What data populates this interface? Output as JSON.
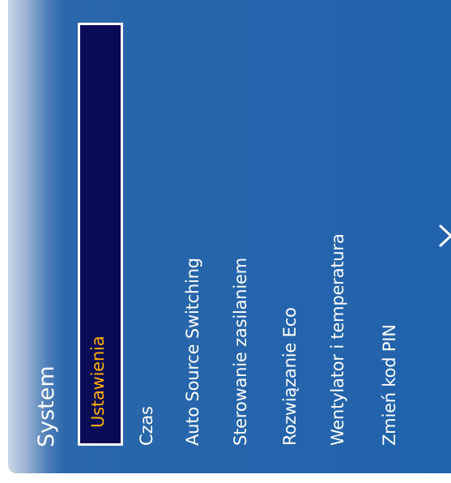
{
  "menu": {
    "title": "System",
    "items": [
      {
        "label": "Ustawienia",
        "selected": true
      },
      {
        "label": "Czas"
      },
      {
        "label": "Auto Source Switching"
      },
      {
        "label": "Sterowanie zasilaniem"
      },
      {
        "label": "Rozwiązanie Eco"
      },
      {
        "label": "Wentylator i temperatura"
      },
      {
        "label": "Zmień kod PIN"
      }
    ],
    "more_icon": "chevron-right-icon"
  },
  "colors": {
    "panel": "#2062ac",
    "selection_bg": "#0a0b57",
    "selected_text": "#ffb000",
    "text": "#ffffff"
  }
}
